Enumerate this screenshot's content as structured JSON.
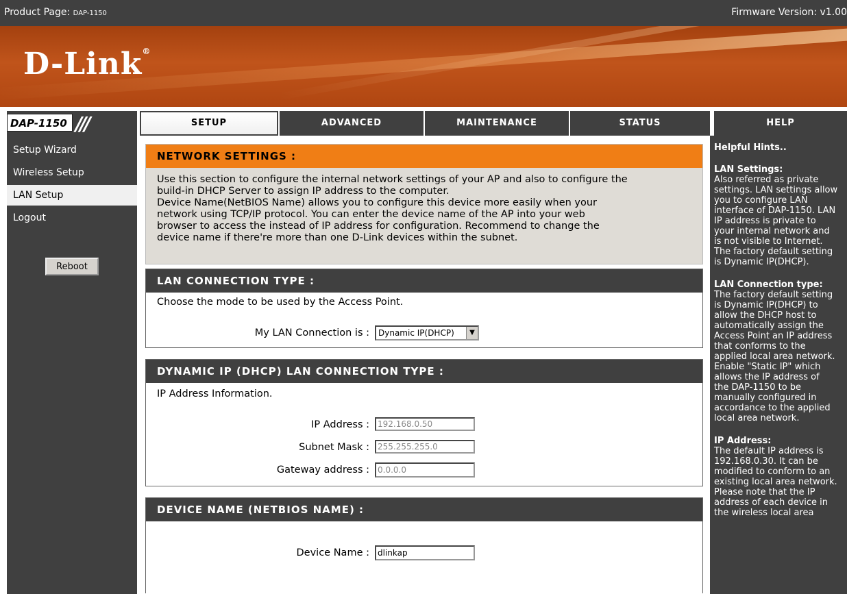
{
  "topbar": {
    "product_label": "Product Page:",
    "product_model": "DAP-1150",
    "firmware": "Firmware Version: v1.00"
  },
  "banner": {
    "logo": "D-Link",
    "registered": "®"
  },
  "model_badge": "DAP-1150",
  "tabs": [
    {
      "label": "SETUP",
      "active": true
    },
    {
      "label": "ADVANCED",
      "active": false
    },
    {
      "label": "MAINTENANCE",
      "active": false
    },
    {
      "label": "STATUS",
      "active": false
    },
    {
      "label": "HELP",
      "active": false
    }
  ],
  "sidebar": {
    "items": [
      {
        "label": "Setup Wizard",
        "active": false
      },
      {
        "label": "Wireless Setup",
        "active": false
      },
      {
        "label": "LAN Setup",
        "active": true
      },
      {
        "label": "Logout",
        "active": false
      }
    ],
    "reboot_label": "Reboot"
  },
  "network": {
    "title": "NETWORK SETTINGS :",
    "lines": [
      "Use this section to configure the internal network settings of your AP and also to configure the",
      "build-in DHCP Server to assign IP address to the computer.",
      "Device Name(NetBIOS Name) allows you to configure this device more easily when your",
      "network using TCP/IP protocol. You can enter the device name of the AP into your web",
      "browser to access the instead of IP address for configuration. Recommend to change the",
      "device name if there're more than one D-Link devices within the subnet."
    ]
  },
  "lan_type": {
    "title": "LAN CONNECTION TYPE :",
    "desc": "Choose the mode to be used by the Access Point.",
    "label": "My LAN Connection is :",
    "value": "Dynamic IP(DHCP)"
  },
  "dhcp": {
    "title": "DYNAMIC IP (DHCP) LAN CONNECTION TYPE :",
    "desc": "IP Address Information.",
    "ip_label": "IP Address :",
    "ip_value": "192.168.0.50",
    "mask_label": "Subnet Mask :",
    "mask_value": "255.255.255.0",
    "gw_label": "Gateway address :",
    "gw_value": "0.0.0.0"
  },
  "device": {
    "title": "DEVICE NAME (NETBIOS NAME) :",
    "label": "Device Name :",
    "value": "dlinkap"
  },
  "help": {
    "title": "Helpful Hints..",
    "sections": [
      {
        "heading": "LAN Settings:",
        "lines": [
          "Also referred as private",
          "settings. LAN settings allow",
          "you to configure LAN",
          "interface of DAP-1150. LAN",
          "IP address is private to",
          "your internal network and",
          "is not visible to Internet.",
          "The factory default setting",
          "is Dynamic IP(DHCP)."
        ]
      },
      {
        "heading": "LAN Connection type:",
        "lines": [
          "The factory default setting",
          "is Dynamic IP(DHCP) to",
          "allow the DHCP host to",
          "automatically assign the",
          "Access Point an IP address",
          "that conforms to the",
          "applied local area network.",
          "Enable \"Static IP\" which",
          "allows the IP address of",
          "the DAP-1150 to be",
          "manually configured in",
          "accordance to the applied",
          "local area network."
        ]
      },
      {
        "heading": "IP Address:",
        "lines": [
          "The default IP address is",
          "192.168.0.30. It can be",
          "modified to conform to an",
          "existing local area network.",
          "Please note that the IP",
          "address of each device in",
          "the wireless local area"
        ]
      }
    ]
  }
}
